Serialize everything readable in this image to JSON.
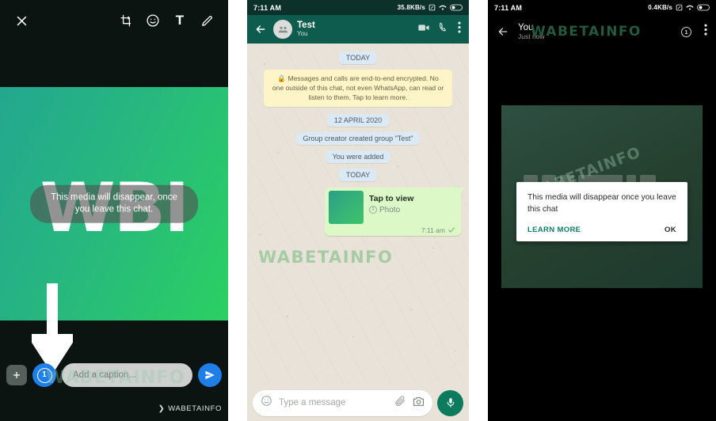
{
  "panel1": {
    "name": "media-editor",
    "toolbar": {
      "close_label": "✕",
      "crop_icon": "crop-rotate-icon",
      "sticker_icon": "emoji-sticker-icon",
      "text_label": "T",
      "draw_icon": "pencil-icon"
    },
    "media": {
      "logo_text": "WBI",
      "overlay_caption": "This media will disappear, once you leave this chat."
    },
    "bottom": {
      "add_media_label": "+",
      "view_once_badge": "1",
      "caption_placeholder": "Add a caption...",
      "send_icon": "send-icon"
    },
    "watermark": "WABETAINFO",
    "watermark_chevron": "❯",
    "overlay_watermark": "WABETAINFO",
    "colors": {
      "accent_blue": "#1e7fe8",
      "media_gradient_start": "#23a78f",
      "media_gradient_end": "#2bd062"
    }
  },
  "panel2": {
    "name": "chat-screen",
    "statusbar": {
      "time": "7:11 AM",
      "network_speed": "35.8KB/s"
    },
    "header": {
      "title": "Test",
      "subtitle": "You",
      "back_icon": "back-arrow-icon",
      "avatar_icon": "group-avatar-icon",
      "video_call_icon": "video-call-icon",
      "voice_call_icon": "phone-call-icon",
      "menu_icon": "overflow-menu-icon"
    },
    "messages": [
      {
        "kind": "date",
        "text": "TODAY"
      },
      {
        "kind": "encryption",
        "text": "Messages and calls are end-to-end encrypted. No one outside of this chat, not even WhatsApp, can read or listen to them. Tap to learn more."
      },
      {
        "kind": "date",
        "text": "12 APRIL 2020"
      },
      {
        "kind": "system",
        "text": "Group creator created group \"Test\""
      },
      {
        "kind": "system",
        "text": "You were added"
      },
      {
        "kind": "date",
        "text": "TODAY"
      }
    ],
    "bubble": {
      "title": "Tap to view",
      "media_type": "Photo",
      "view_once_icon": "view-once-icon",
      "time": "7:11 am",
      "status_icon": "sent-check-icon"
    },
    "watermark": "WABETAINFO",
    "input": {
      "emoji_icon": "emoji-icon",
      "placeholder": "Type a message",
      "attach_icon": "paperclip-icon",
      "camera_icon": "camera-icon",
      "mic_icon": "microphone-icon"
    },
    "colors": {
      "header_green": "#0d5c4d",
      "bubble_green": "#dcf8c6",
      "chat_bg": "#e9e2d9",
      "mic_green": "#0c7a5d"
    }
  },
  "panel3": {
    "name": "view-once-viewer",
    "statusbar": {
      "time": "7:11 AM",
      "network_speed": "0.4KB/s"
    },
    "header": {
      "back_icon": "back-arrow-icon",
      "title": "You",
      "subtitle": "Just now",
      "view_once_badge": "1",
      "menu_icon": "overflow-menu-icon"
    },
    "dialog": {
      "text": "This media will disappear once you leave this chat",
      "learn_more_label": "LEARN MORE",
      "ok_label": "OK"
    },
    "watermark_header": "WABETAINFO",
    "watermark_diagonal": "WABETAINFO",
    "colors": {
      "learn_more": "#0f7d68",
      "ok": "#2d2d2d",
      "media_bg": "#2e4f42"
    }
  }
}
